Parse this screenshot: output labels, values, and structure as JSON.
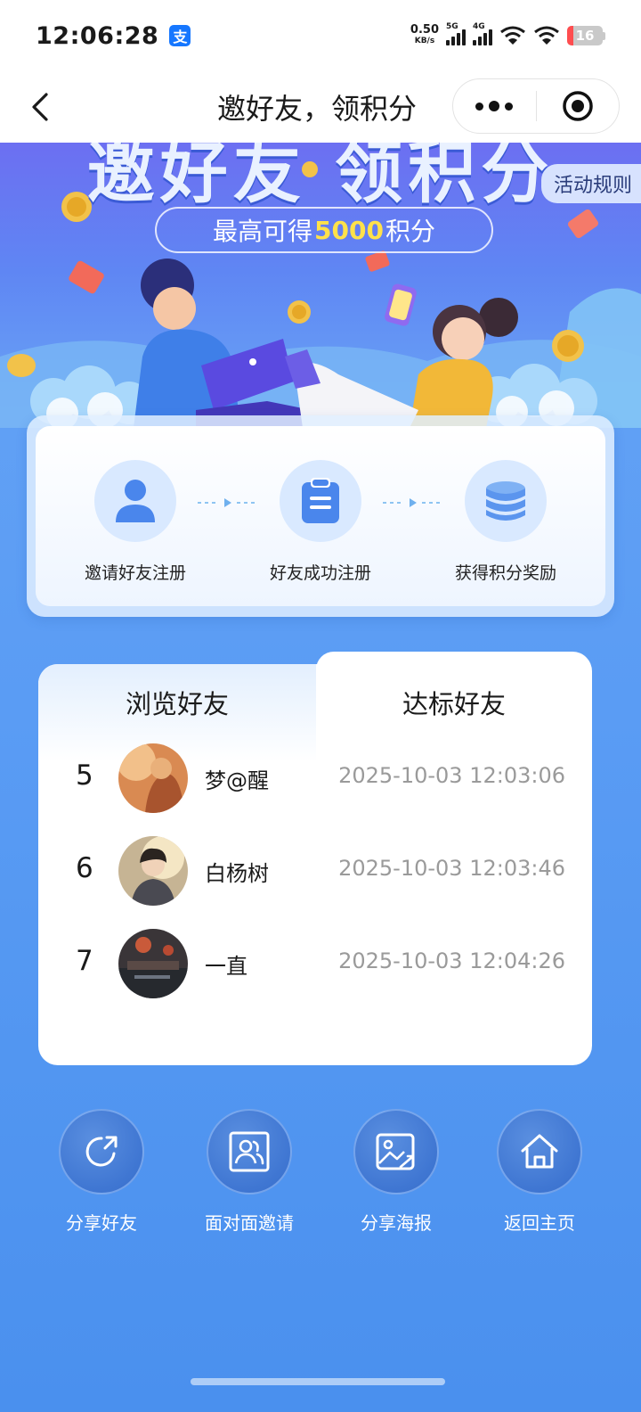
{
  "status_bar": {
    "time": "12:06:28",
    "app_badge": "支",
    "net_speed_value": "0.50",
    "net_speed_unit": "KB/s",
    "sim1_label": "5G",
    "sim2_label": "4G",
    "battery": "16"
  },
  "nav": {
    "title": "邀好友，领积分",
    "back_icon": "chevron-left-icon",
    "more_icon": "more-dots-icon",
    "close_icon": "target-circle-icon"
  },
  "banner": {
    "title": "邀好友 领积分",
    "rules_label": "活动规则",
    "max_prefix": "最高可得",
    "max_amount": "5000",
    "max_suffix": "积分"
  },
  "steps": [
    {
      "label": "邀请好友注册",
      "icon": "user-icon"
    },
    {
      "label": "好友成功注册",
      "icon": "clipboard-icon"
    },
    {
      "label": "获得积分奖励",
      "icon": "coin-stack-icon"
    }
  ],
  "tabs": {
    "browse_label": "浏览好友",
    "qualified_label": "达标好友",
    "active": "qualified"
  },
  "friends": [
    {
      "rank": "5",
      "name": "梦@醒",
      "time": "2025-10-03 12:03:06"
    },
    {
      "rank": "6",
      "name": "白杨树",
      "time": "2025-10-03 12:03:46"
    },
    {
      "rank": "7",
      "name": "一直",
      "time": "2025-10-03 12:04:26"
    }
  ],
  "actions": [
    {
      "label": "分享好友",
      "icon": "share-icon"
    },
    {
      "label": "面对面邀请",
      "icon": "contact-card-icon"
    },
    {
      "label": "分享海报",
      "icon": "poster-image-icon"
    },
    {
      "label": "返回主页",
      "icon": "home-icon"
    }
  ],
  "colors": {
    "background": "#5a9cf4",
    "highlight": "#ffe14a",
    "step_circle": "#d9e9ff",
    "step_icon": "#4a86ec"
  }
}
